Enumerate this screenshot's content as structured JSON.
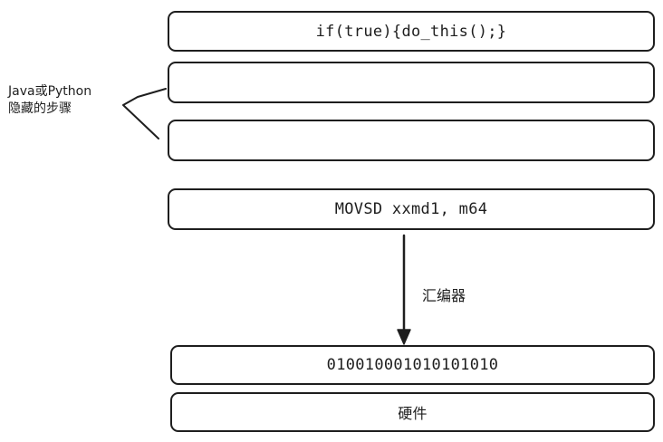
{
  "diagram": {
    "boxes": [
      {
        "id": "box1",
        "text": "if(true){do_this();}"
      },
      {
        "id": "box2",
        "text": ""
      },
      {
        "id": "box3",
        "text": ""
      },
      {
        "id": "box4",
        "text": "MOVSD xxmd1, m64"
      },
      {
        "id": "box5",
        "text": "010010001010101010"
      },
      {
        "id": "box6",
        "text": "硬件"
      }
    ],
    "side_label": {
      "line1": "Java或Python",
      "line2": "隐藏的步骤"
    },
    "arrow_label": "汇编器",
    "stroke_color": "#1e1e1e"
  }
}
